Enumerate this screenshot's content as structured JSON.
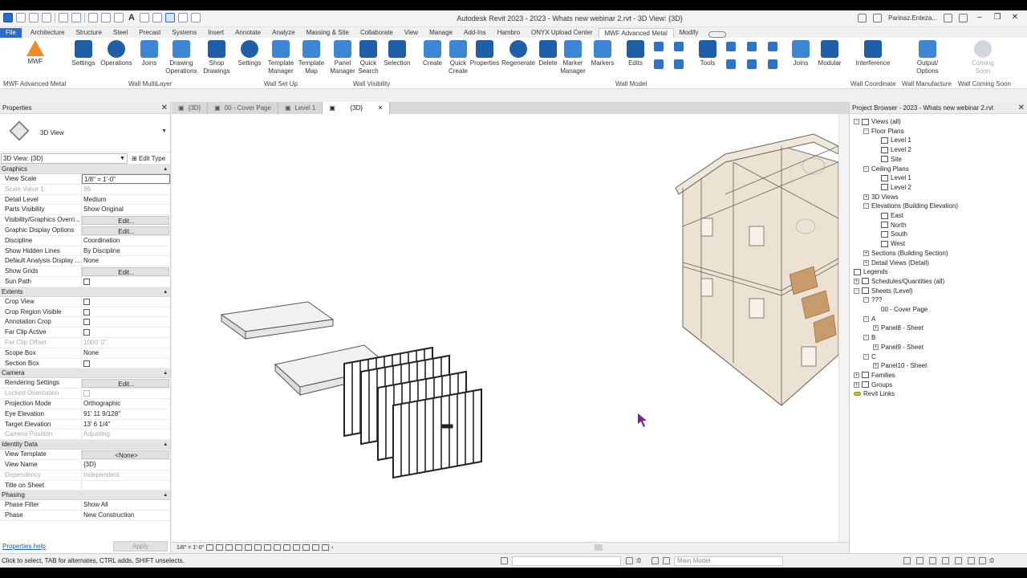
{
  "app": {
    "title": "Autodesk Revit 2023 - 2023 - Whats new webinar 2.rvt - 3D View: {3D}",
    "user": "Parinaz.Enteza...",
    "qat_icons": [
      "revit-logo-icon",
      "open-icon",
      "save-icon",
      "sync-icon",
      "undo-icon",
      "redo-icon",
      "print-icon",
      "measure-icon",
      "dimension-icon",
      "text-icon",
      "3d-view-icon",
      "section-icon",
      "thin-lines-icon",
      "close-hidden-icon",
      "switch-windows-icon"
    ]
  },
  "ribbon_tabs": [
    "File",
    "Architecture",
    "Structure",
    "Steel",
    "Precast",
    "Systems",
    "Insert",
    "Annotate",
    "Analyze",
    "Massing & Site",
    "Collaborate",
    "View",
    "Manage",
    "Add-Ins",
    "Hambro",
    "ONYX Upload Center",
    "MWF Advanced Metal",
    "Modify"
  ],
  "active_tab": "MWF Advanced Metal",
  "ribbon": {
    "mwf": "MWF",
    "settings": "Settings",
    "operations": "Operations",
    "joins": "Joins",
    "drawing_operations": "Drawing Operations",
    "shop_drawings": "Shop Drawings",
    "settings2": "Settings",
    "template_manager": "Template Manager",
    "template_map": "Template Map",
    "panel_manager": "Panel Manager",
    "quick_search": "Quick Search",
    "selection": "Selection",
    "create": "Create",
    "quick_create": "Quick Create",
    "properties": "Properties",
    "regenerate": "Regenerate",
    "delete": "Delete",
    "marker_manager": "Marker Manager",
    "markers": "Markers",
    "edits": "Edits",
    "tools": "Tools",
    "joins2": "Joins",
    "modular": "Modular",
    "interference": "Interference",
    "output_options": "Output/ Options",
    "coming_soon": "Coming Soon",
    "panels": {
      "p1": "MWF Advanced Metal",
      "p2": "Wall MultiLayer",
      "p3": "Wall Set Up",
      "p4": "Wall Visibility",
      "p5": "Wall Model",
      "p6": "Wall Coordinate",
      "p7": "Wall Manufacture",
      "p8": "Wall Coming Soon"
    }
  },
  "doc_tabs": [
    {
      "label": "{3D}",
      "active": false
    },
    {
      "label": "00 - Cover Page",
      "active": false
    },
    {
      "label": "Level 1",
      "active": false
    },
    {
      "label": "{3D}",
      "active": true
    }
  ],
  "properties": {
    "header": "Properties",
    "type_name": "3D View",
    "view_selector": "3D View: {3D}",
    "edit_type": "Edit Type",
    "help": "Properties help",
    "apply": "Apply",
    "sections": {
      "graphics": "Graphics",
      "extents": "Extents",
      "camera": "Camera",
      "identity": "Identity Data",
      "phasing": "Phasing"
    },
    "graphics": [
      {
        "name": "View Scale",
        "value": "1/8\" = 1'-0\""
      },
      {
        "name": "Scale Value    1:",
        "value": "96"
      },
      {
        "name": "Detail Level",
        "value": "Medium"
      },
      {
        "name": "Parts Visibility",
        "value": "Show Original"
      },
      {
        "name": "Visibility/Graphics Overri...",
        "value": "Edit..."
      },
      {
        "name": "Graphic Display Options",
        "value": "Edit..."
      },
      {
        "name": "Discipline",
        "value": "Coordination"
      },
      {
        "name": "Show Hidden Lines",
        "value": "By Discipline"
      },
      {
        "name": "Default Analysis Display ...",
        "value": "None"
      },
      {
        "name": "Show Grids",
        "value": "Edit..."
      },
      {
        "name": "Sun Path",
        "value": ""
      }
    ],
    "extents": [
      {
        "name": "Crop View",
        "value": ""
      },
      {
        "name": "Crop Region Visible",
        "value": ""
      },
      {
        "name": "Annotation Crop",
        "value": ""
      },
      {
        "name": "Far Clip Active",
        "value": ""
      },
      {
        "name": "Far Clip Offset",
        "value": "1000'  0\""
      },
      {
        "name": "Scope Box",
        "value": "None"
      },
      {
        "name": "Section Box",
        "value": ""
      }
    ],
    "camera": [
      {
        "name": "Rendering Settings",
        "value": "Edit..."
      },
      {
        "name": "Locked Orientation",
        "value": ""
      },
      {
        "name": "Projection Mode",
        "value": "Orthographic"
      },
      {
        "name": "Eye Elevation",
        "value": "91'  11 9/128\""
      },
      {
        "name": "Target Elevation",
        "value": "13'  6 1/4\""
      },
      {
        "name": "Camera Position",
        "value": "Adjusting"
      }
    ],
    "identity": [
      {
        "name": "View Template",
        "value": "<None>"
      },
      {
        "name": "View Name",
        "value": "{3D}"
      },
      {
        "name": "Dependency",
        "value": "Independent"
      },
      {
        "name": "Title on Sheet",
        "value": ""
      }
    ],
    "phasing": [
      {
        "name": "Phase Filter",
        "value": "Show All"
      },
      {
        "name": "Phase",
        "value": "New Construction"
      }
    ]
  },
  "view_control": {
    "scale": "1/8\" = 1'-0\""
  },
  "browser": {
    "title": "Project Browser - 2023 - Whats new webinar 2.rvt",
    "items": [
      "Views (all)",
      "Floor Plans",
      "Level 1",
      "Level 2",
      "Site",
      "Ceiling Plans",
      "Level 1",
      "Level 2",
      "3D Views",
      "Elevations (Building Elevation)",
      "East",
      "North",
      "South",
      "West",
      "Sections (Building Section)",
      "Detail Views (Detail)",
      "Legends",
      "Schedules/Quantities (all)",
      "Sheets (Level)",
      "???",
      "00 - Cover Page",
      "A",
      "Panel8 - Sheet",
      "B",
      "Panel9 - Sheet",
      "C",
      "Panel10 - Sheet",
      "Families",
      "Groups",
      "Revit Links"
    ]
  },
  "status": {
    "text": "Click to select, TAB for alternates, CTRL adds, SHIFT unselects.",
    "coord": ":0",
    "model": "Main Model",
    "filter_count": ":0"
  },
  "colors": {
    "accent": "#2a6bd1",
    "house_fill": "#e9dfcf",
    "house_line": "#6b6258",
    "stair": "#b07a44"
  }
}
